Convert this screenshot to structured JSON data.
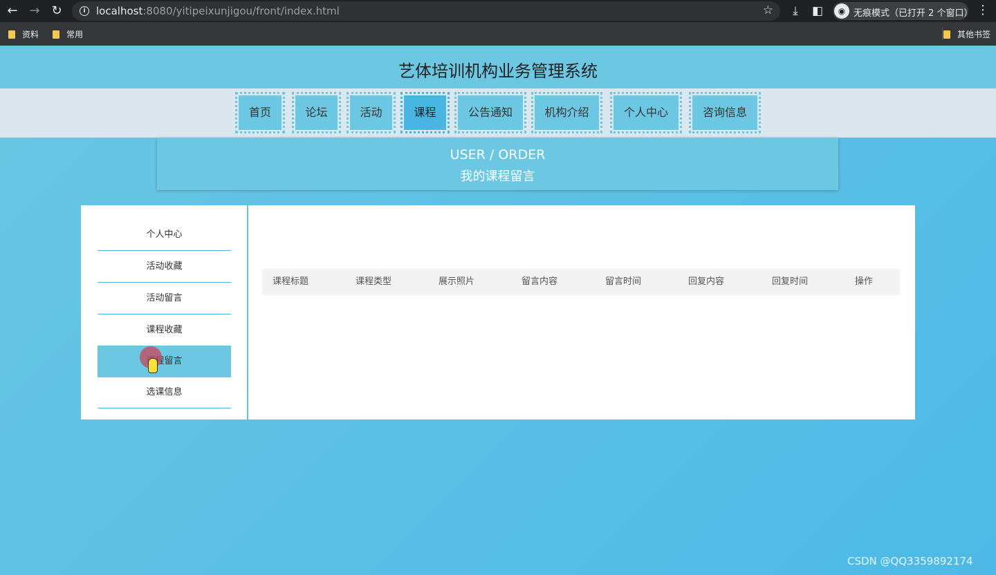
{
  "browser": {
    "url_host": "localhost",
    "url_rest": ":8080/yitipeixunjigou/front/index.html",
    "incognito_label": "无痕模式（已打开 2 个窗口）",
    "bookmarks": [
      "资料",
      "常用"
    ],
    "other_bookmarks": "其他书签"
  },
  "header": {
    "title": "艺体培训机构业务管理系统"
  },
  "nav": {
    "items": [
      "首页",
      "论坛",
      "活动",
      "课程",
      "公告通知",
      "机构介绍",
      "个人中心",
      "咨询信息"
    ],
    "active": "课程"
  },
  "banner": {
    "en": "USER / ORDER",
    "cn": "我的课程留言"
  },
  "side_menu": {
    "items": [
      "个人中心",
      "活动收藏",
      "活动留言",
      "课程收藏",
      "课程留言",
      "选课信息"
    ],
    "active": "课程留言"
  },
  "table": {
    "columns": [
      "课程标题",
      "课程类型",
      "展示照片",
      "留言内容",
      "留言时间",
      "回复内容",
      "回复时间",
      "操作"
    ]
  },
  "watermark": "CSDN @QQ3359892174"
}
